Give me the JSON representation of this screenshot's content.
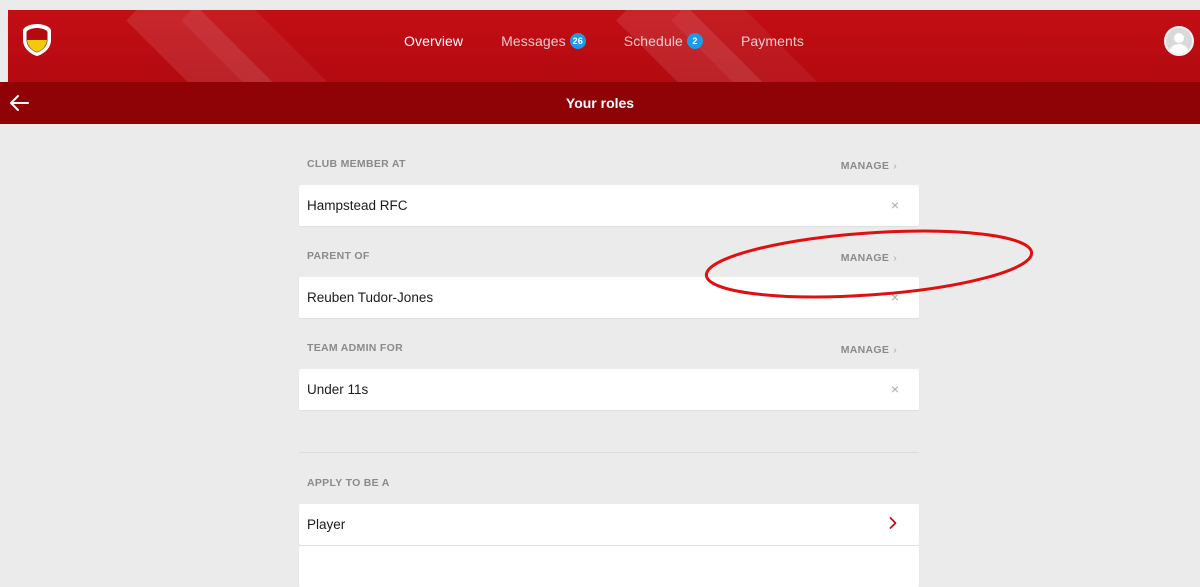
{
  "nav": {
    "items": [
      {
        "label": "Overview",
        "badge": null
      },
      {
        "label": "Messages",
        "badge": "26"
      },
      {
        "label": "Schedule",
        "badge": "2"
      },
      {
        "label": "Payments",
        "badge": null
      }
    ]
  },
  "subheader": {
    "title": "Your roles"
  },
  "sections": {
    "club": {
      "label": "CLUB MEMBER AT",
      "manage": "MANAGE",
      "item": "Hampstead RFC",
      "remove": "×"
    },
    "parent": {
      "label": "PARENT OF",
      "manage": "MANAGE",
      "item": "Reuben Tudor-Jones",
      "remove": "×"
    },
    "team": {
      "label": "TEAM ADMIN FOR",
      "manage": "MANAGE",
      "item": "Under 11s",
      "remove": "×"
    },
    "apply": {
      "label": "APPLY TO BE A",
      "items": [
        "Player"
      ]
    }
  },
  "colors": {
    "brand": "#c30e14",
    "subbar": "#8f0307",
    "badge": "#1d9be6",
    "annotation": "#e01010"
  }
}
